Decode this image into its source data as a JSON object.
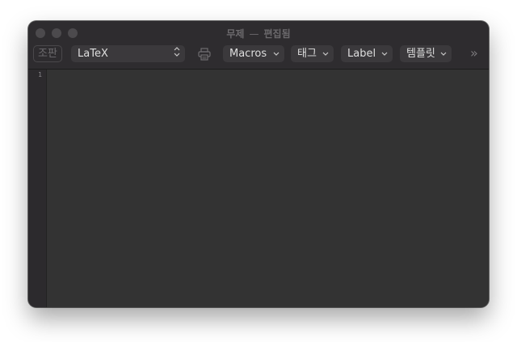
{
  "window": {
    "title": "무제",
    "separator": "—",
    "status": "편집됨"
  },
  "toolbar": {
    "typeset_label": "조판",
    "engine_value": "LaTeX",
    "macros_label": "Macros",
    "tags_label": "태그",
    "label_label": "Label",
    "template_label": "템플릿",
    "overflow_label": "»"
  },
  "editor": {
    "line_numbers": [
      "1"
    ],
    "content": ""
  },
  "icons": {
    "print": "printer-icon",
    "chevron": "chevron-down-icon",
    "updown": "updown-icon"
  }
}
